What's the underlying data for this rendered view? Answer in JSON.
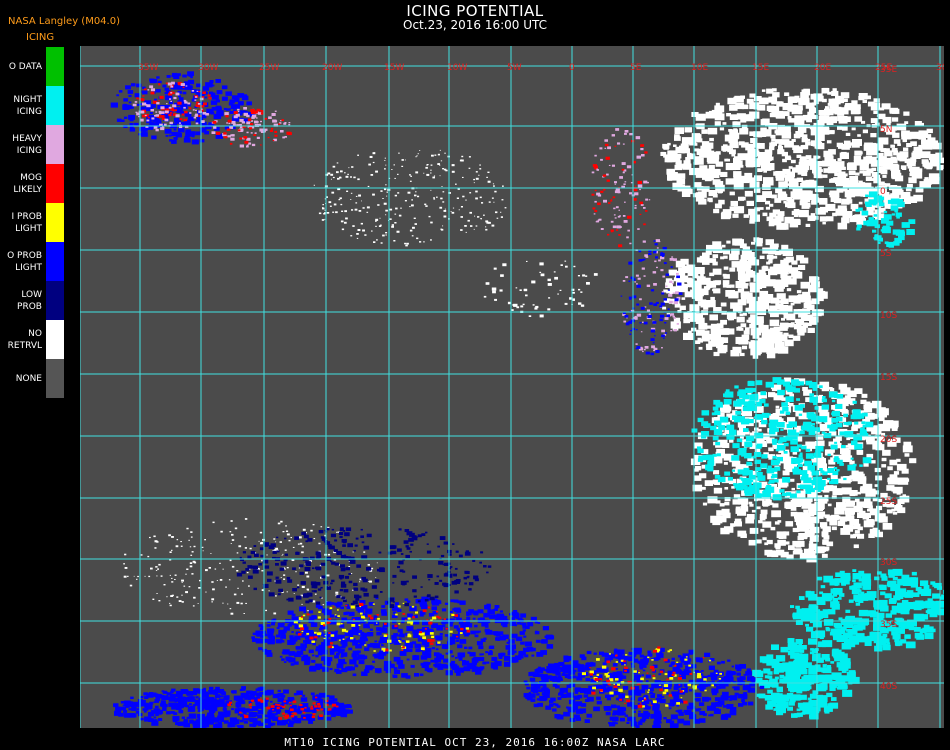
{
  "header": {
    "source": "NASA Langley (M04.0)",
    "product": "ICING",
    "title": "ICING POTENTIAL",
    "subtitle": "Oct.23, 2016 16:00 UTC"
  },
  "legend": [
    {
      "label": "O DATA",
      "color": "#00c000"
    },
    {
      "label": "NIGHT\nICING",
      "color": "#00f0f0"
    },
    {
      "label": "HEAVY\nICING",
      "color": "#e0a8e0"
    },
    {
      "label": "MOG\nLIKELY",
      "color": "#ff0000"
    },
    {
      "label": "I PROB\nLIGHT",
      "color": "#ffff00"
    },
    {
      "label": "O PROB\nLIGHT",
      "color": "#0000ff"
    },
    {
      "label": "LOW\nPROB",
      "color": "#000080"
    },
    {
      "label": "NO\nRETRVL",
      "color": "#ffffff"
    },
    {
      "label": "NONE",
      "color": "#555555"
    }
  ],
  "map": {
    "background": "#4b4b4b",
    "grid_color": "#40e0e0",
    "top_labels": [
      "35W",
      "30W",
      "25W",
      "20W",
      "15W",
      "10W",
      "5W",
      "0",
      "5E",
      "10E",
      "15E",
      "20E",
      "25E",
      "30E",
      "35E"
    ],
    "right_labels": [
      "35E",
      "5N",
      "0",
      "5S",
      "10S",
      "15S",
      "20S",
      "25S",
      "30S",
      "35S",
      "40S"
    ]
  },
  "footer": {
    "text": "MT10  ICING POTENTIAL   OCT 23, 2016 16:00Z   NASA LARC"
  }
}
